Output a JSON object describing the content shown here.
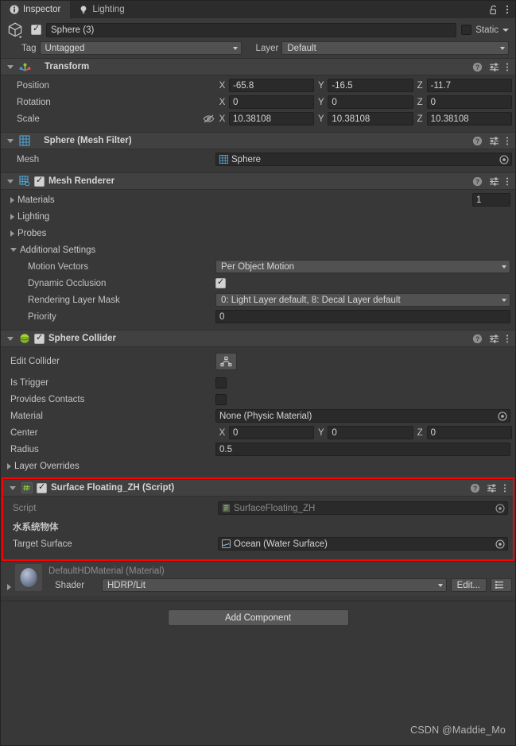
{
  "window": {
    "title": "Inspector"
  },
  "tabs": [
    {
      "label": "Inspector",
      "icon": "info-icon",
      "active": true
    },
    {
      "label": "Lighting",
      "icon": "light-bulb-icon",
      "active": false
    }
  ],
  "tabbar_actions": [
    {
      "name": "lock-icon",
      "glyph": "lock"
    },
    {
      "name": "kebab-menu-icon",
      "glyph": "kebab"
    }
  ],
  "object_header": {
    "icon": "prefab-cube-icon",
    "enabled": true,
    "name": "Sphere (3)",
    "static_label": "Static",
    "static_checked": false,
    "tag_label": "Tag",
    "tag_value": "Untagged",
    "layer_label": "Layer",
    "layer_value": "Default"
  },
  "components": [
    {
      "id": "transform",
      "icon": "transform-axis-icon",
      "title": "Transform",
      "expanded": true,
      "has_checkbox": false,
      "rows": [
        {
          "type": "vector3",
          "label": "Position",
          "x": "-65.8",
          "y": "-16.5",
          "z": "-11.7"
        },
        {
          "type": "vector3",
          "label": "Rotation",
          "x": "0",
          "y": "0",
          "z": "0"
        },
        {
          "type": "vector3",
          "label": "Scale",
          "x": "10.38108",
          "y": "10.38108",
          "z": "10.38108",
          "constrain_icon": "constrain-proportions-off-icon"
        }
      ]
    },
    {
      "id": "mesh-filter",
      "icon": "mesh-filter-icon",
      "title": "Sphere (Mesh Filter)",
      "expanded": true,
      "has_checkbox": false,
      "rows": [
        {
          "type": "object",
          "label": "Mesh",
          "value": "Sphere",
          "value_icon": "mesh-icon"
        }
      ]
    },
    {
      "id": "mesh-renderer",
      "icon": "mesh-renderer-icon",
      "title": "Mesh Renderer",
      "expanded": true,
      "has_checkbox": true,
      "checked": true,
      "rows": [
        {
          "type": "foldout-count",
          "label": "Materials",
          "expanded": false,
          "count": "1"
        },
        {
          "type": "foldout",
          "label": "Lighting",
          "expanded": false
        },
        {
          "type": "foldout",
          "label": "Probes",
          "expanded": false
        },
        {
          "type": "foldout",
          "label": "Additional Settings",
          "expanded": true
        },
        {
          "type": "popup",
          "label": "Motion Vectors",
          "value": "Per Object Motion",
          "indent": true
        },
        {
          "type": "checkbox",
          "label": "Dynamic Occlusion",
          "checked": true,
          "indent": true
        },
        {
          "type": "popup",
          "label": "Rendering Layer Mask",
          "value": "0: Light Layer default, 8: Decal Layer default",
          "indent": true
        },
        {
          "type": "text",
          "label": "Priority",
          "value": "0",
          "indent": true
        }
      ]
    },
    {
      "id": "sphere-collider",
      "icon": "sphere-collider-icon",
      "title": "Sphere Collider",
      "expanded": true,
      "has_checkbox": true,
      "checked": true,
      "rows": [
        {
          "type": "edit-collider",
          "label": "Edit Collider",
          "button_icon": "edit-collider-icon"
        },
        {
          "type": "checkbox",
          "label": "Is Trigger",
          "checked": false
        },
        {
          "type": "checkbox",
          "label": "Provides Contacts",
          "checked": false
        },
        {
          "type": "object",
          "label": "Material",
          "value": "None (Physic Material)",
          "value_icon": ""
        },
        {
          "type": "vector3",
          "label": "Center",
          "x": "0",
          "y": "0",
          "z": "0"
        },
        {
          "type": "text-wide",
          "label": "Radius",
          "value": "0.5"
        },
        {
          "type": "foldout",
          "label": "Layer Overrides",
          "expanded": false
        }
      ]
    },
    {
      "id": "surface-floating-script",
      "icon": "csharp-script-icon",
      "title": "Surface Floating_ZH (Script)",
      "expanded": true,
      "has_checkbox": true,
      "checked": true,
      "highlighted": true,
      "highlight_color": "#ff0000",
      "rows": [
        {
          "type": "object-disabled",
          "label": "Script",
          "value": "SurfaceFloating_ZH",
          "value_icon": "script-asset-icon"
        },
        {
          "type": "header",
          "label": "水系统物体"
        },
        {
          "type": "object",
          "label": "Target Surface",
          "value": "Ocean (Water Surface)",
          "value_icon": "water-surface-icon"
        }
      ]
    }
  ],
  "material_preview": {
    "thumbnail_icon": "material-sphere-icon",
    "name": "DefaultHDMaterial (Material)",
    "shader_label": "Shader",
    "shader_value": "HDRP/Lit",
    "edit_label": "Edit...",
    "list_icon": "shader-list-icon"
  },
  "add_component": {
    "label": "Add Component"
  },
  "watermark": {
    "text": "CSDN @Maddie_Mo"
  },
  "header_icons": {
    "help": "help-icon",
    "preset": "preset-icon",
    "menu": "kebab-menu-icon"
  }
}
